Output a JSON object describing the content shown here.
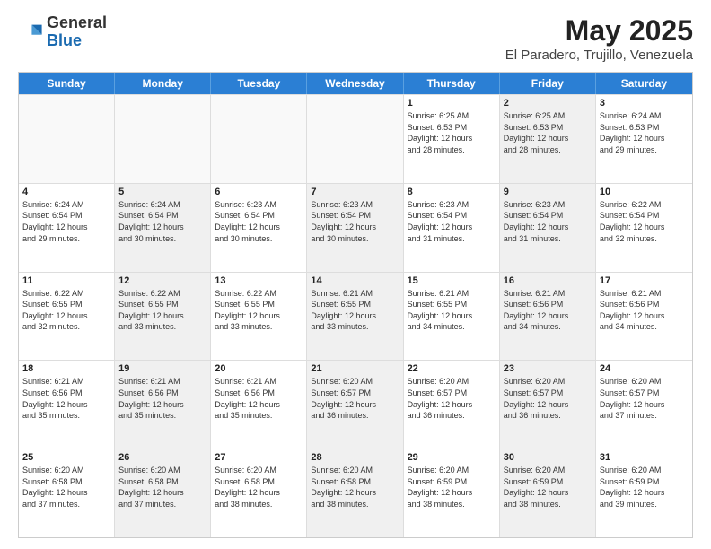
{
  "logo": {
    "general": "General",
    "blue": "Blue"
  },
  "title": {
    "month": "May 2025",
    "location": "El Paradero, Trujillo, Venezuela"
  },
  "header_days": [
    "Sunday",
    "Monday",
    "Tuesday",
    "Wednesday",
    "Thursday",
    "Friday",
    "Saturday"
  ],
  "weeks": [
    [
      {
        "day": "",
        "info": "",
        "shaded": false,
        "empty": true
      },
      {
        "day": "",
        "info": "",
        "shaded": false,
        "empty": true
      },
      {
        "day": "",
        "info": "",
        "shaded": false,
        "empty": true
      },
      {
        "day": "",
        "info": "",
        "shaded": false,
        "empty": true
      },
      {
        "day": "1",
        "info": "Sunrise: 6:25 AM\nSunset: 6:53 PM\nDaylight: 12 hours\nand 28 minutes.",
        "shaded": false,
        "empty": false
      },
      {
        "day": "2",
        "info": "Sunrise: 6:25 AM\nSunset: 6:53 PM\nDaylight: 12 hours\nand 28 minutes.",
        "shaded": true,
        "empty": false
      },
      {
        "day": "3",
        "info": "Sunrise: 6:24 AM\nSunset: 6:53 PM\nDaylight: 12 hours\nand 29 minutes.",
        "shaded": false,
        "empty": false
      }
    ],
    [
      {
        "day": "4",
        "info": "Sunrise: 6:24 AM\nSunset: 6:54 PM\nDaylight: 12 hours\nand 29 minutes.",
        "shaded": false,
        "empty": false
      },
      {
        "day": "5",
        "info": "Sunrise: 6:24 AM\nSunset: 6:54 PM\nDaylight: 12 hours\nand 30 minutes.",
        "shaded": true,
        "empty": false
      },
      {
        "day": "6",
        "info": "Sunrise: 6:23 AM\nSunset: 6:54 PM\nDaylight: 12 hours\nand 30 minutes.",
        "shaded": false,
        "empty": false
      },
      {
        "day": "7",
        "info": "Sunrise: 6:23 AM\nSunset: 6:54 PM\nDaylight: 12 hours\nand 30 minutes.",
        "shaded": true,
        "empty": false
      },
      {
        "day": "8",
        "info": "Sunrise: 6:23 AM\nSunset: 6:54 PM\nDaylight: 12 hours\nand 31 minutes.",
        "shaded": false,
        "empty": false
      },
      {
        "day": "9",
        "info": "Sunrise: 6:23 AM\nSunset: 6:54 PM\nDaylight: 12 hours\nand 31 minutes.",
        "shaded": true,
        "empty": false
      },
      {
        "day": "10",
        "info": "Sunrise: 6:22 AM\nSunset: 6:54 PM\nDaylight: 12 hours\nand 32 minutes.",
        "shaded": false,
        "empty": false
      }
    ],
    [
      {
        "day": "11",
        "info": "Sunrise: 6:22 AM\nSunset: 6:55 PM\nDaylight: 12 hours\nand 32 minutes.",
        "shaded": false,
        "empty": false
      },
      {
        "day": "12",
        "info": "Sunrise: 6:22 AM\nSunset: 6:55 PM\nDaylight: 12 hours\nand 33 minutes.",
        "shaded": true,
        "empty": false
      },
      {
        "day": "13",
        "info": "Sunrise: 6:22 AM\nSunset: 6:55 PM\nDaylight: 12 hours\nand 33 minutes.",
        "shaded": false,
        "empty": false
      },
      {
        "day": "14",
        "info": "Sunrise: 6:21 AM\nSunset: 6:55 PM\nDaylight: 12 hours\nand 33 minutes.",
        "shaded": true,
        "empty": false
      },
      {
        "day": "15",
        "info": "Sunrise: 6:21 AM\nSunset: 6:55 PM\nDaylight: 12 hours\nand 34 minutes.",
        "shaded": false,
        "empty": false
      },
      {
        "day": "16",
        "info": "Sunrise: 6:21 AM\nSunset: 6:56 PM\nDaylight: 12 hours\nand 34 minutes.",
        "shaded": true,
        "empty": false
      },
      {
        "day": "17",
        "info": "Sunrise: 6:21 AM\nSunset: 6:56 PM\nDaylight: 12 hours\nand 34 minutes.",
        "shaded": false,
        "empty": false
      }
    ],
    [
      {
        "day": "18",
        "info": "Sunrise: 6:21 AM\nSunset: 6:56 PM\nDaylight: 12 hours\nand 35 minutes.",
        "shaded": false,
        "empty": false
      },
      {
        "day": "19",
        "info": "Sunrise: 6:21 AM\nSunset: 6:56 PM\nDaylight: 12 hours\nand 35 minutes.",
        "shaded": true,
        "empty": false
      },
      {
        "day": "20",
        "info": "Sunrise: 6:21 AM\nSunset: 6:56 PM\nDaylight: 12 hours\nand 35 minutes.",
        "shaded": false,
        "empty": false
      },
      {
        "day": "21",
        "info": "Sunrise: 6:20 AM\nSunset: 6:57 PM\nDaylight: 12 hours\nand 36 minutes.",
        "shaded": true,
        "empty": false
      },
      {
        "day": "22",
        "info": "Sunrise: 6:20 AM\nSunset: 6:57 PM\nDaylight: 12 hours\nand 36 minutes.",
        "shaded": false,
        "empty": false
      },
      {
        "day": "23",
        "info": "Sunrise: 6:20 AM\nSunset: 6:57 PM\nDaylight: 12 hours\nand 36 minutes.",
        "shaded": true,
        "empty": false
      },
      {
        "day": "24",
        "info": "Sunrise: 6:20 AM\nSunset: 6:57 PM\nDaylight: 12 hours\nand 37 minutes.",
        "shaded": false,
        "empty": false
      }
    ],
    [
      {
        "day": "25",
        "info": "Sunrise: 6:20 AM\nSunset: 6:58 PM\nDaylight: 12 hours\nand 37 minutes.",
        "shaded": false,
        "empty": false
      },
      {
        "day": "26",
        "info": "Sunrise: 6:20 AM\nSunset: 6:58 PM\nDaylight: 12 hours\nand 37 minutes.",
        "shaded": true,
        "empty": false
      },
      {
        "day": "27",
        "info": "Sunrise: 6:20 AM\nSunset: 6:58 PM\nDaylight: 12 hours\nand 38 minutes.",
        "shaded": false,
        "empty": false
      },
      {
        "day": "28",
        "info": "Sunrise: 6:20 AM\nSunset: 6:58 PM\nDaylight: 12 hours\nand 38 minutes.",
        "shaded": true,
        "empty": false
      },
      {
        "day": "29",
        "info": "Sunrise: 6:20 AM\nSunset: 6:59 PM\nDaylight: 12 hours\nand 38 minutes.",
        "shaded": false,
        "empty": false
      },
      {
        "day": "30",
        "info": "Sunrise: 6:20 AM\nSunset: 6:59 PM\nDaylight: 12 hours\nand 38 minutes.",
        "shaded": true,
        "empty": false
      },
      {
        "day": "31",
        "info": "Sunrise: 6:20 AM\nSunset: 6:59 PM\nDaylight: 12 hours\nand 39 minutes.",
        "shaded": false,
        "empty": false
      }
    ]
  ]
}
